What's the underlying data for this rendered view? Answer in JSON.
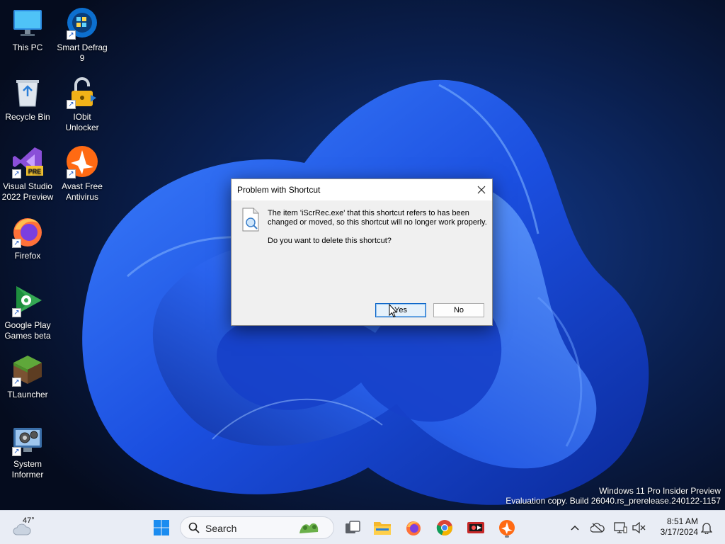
{
  "desktop": {
    "icons": [
      {
        "label": "This PC",
        "shortcut": false
      },
      {
        "label": "Smart Defrag 9",
        "shortcut": true
      },
      {
        "label": "Recycle Bin",
        "shortcut": false
      },
      {
        "label": "IObit Unlocker",
        "shortcut": true
      },
      {
        "label": "Visual Studio 2022 Preview",
        "shortcut": true,
        "badge": "PRE"
      },
      {
        "label": "Avast Free Antivirus",
        "shortcut": true
      },
      {
        "label": "Firefox",
        "shortcut": true
      },
      {
        "label": "Google Play Games beta",
        "shortcut": true
      },
      {
        "label": "TLauncher",
        "shortcut": true
      },
      {
        "label": "System Informer",
        "shortcut": true
      }
    ],
    "watermark_line1": "Windows 11 Pro Insider Preview",
    "watermark_line2": "Evaluation copy. Build 26040.rs_prerelease.240122-1157"
  },
  "dialog": {
    "title": "Problem with Shortcut",
    "message": "The item 'iScrRec.exe' that this shortcut refers to has been changed or moved, so this shortcut will no longer work properly.",
    "question": "Do you want to delete this shortcut?",
    "yes_label": "Yes",
    "no_label": "No"
  },
  "taskbar": {
    "weather_temp": "47°",
    "search_placeholder": "Search",
    "time": "8:51 AM",
    "date": "3/17/2024",
    "pinned_apps": [
      "task-view",
      "file-explorer",
      "firefox",
      "chrome",
      "screen-recorder",
      "avast"
    ]
  },
  "colors": {
    "accent": "#0a64c8",
    "wallpaper_bloom": "#1f5fe8",
    "taskbar_bg": "#e9edf5"
  }
}
